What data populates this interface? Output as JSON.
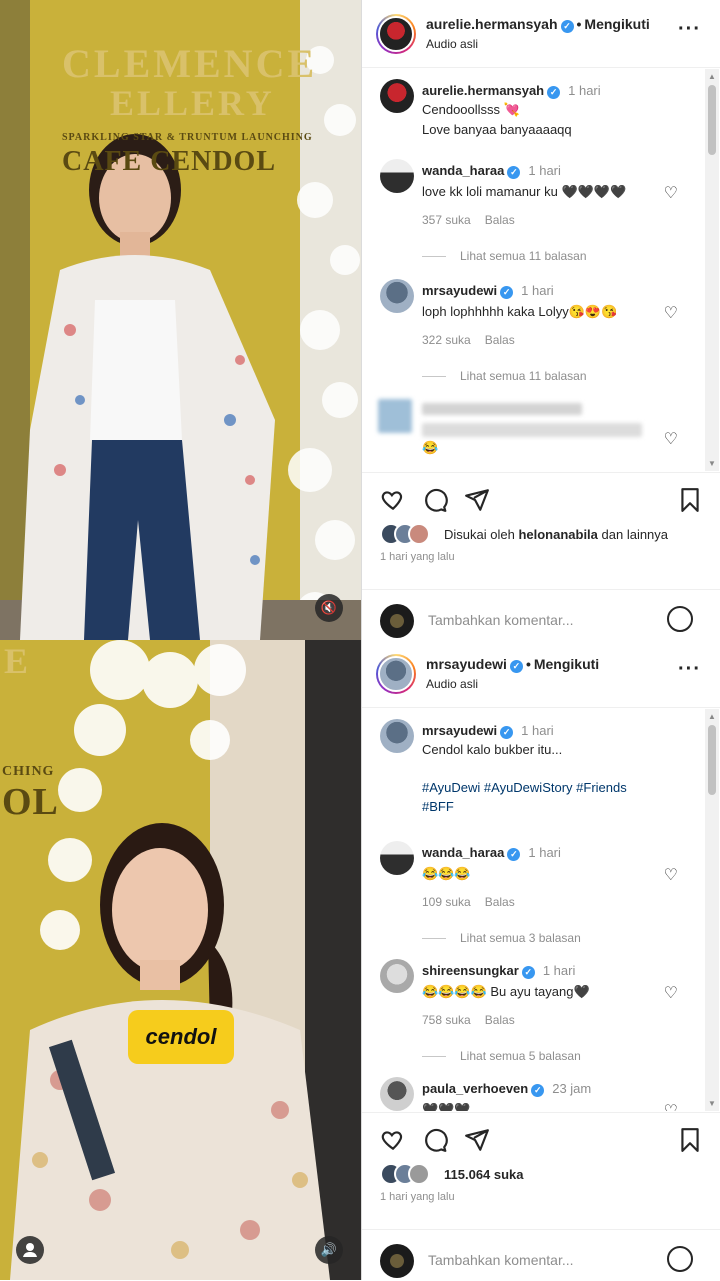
{
  "posts": [
    {
      "header": {
        "username": "aurelie.hermansyah",
        "follow": "Mengikuti",
        "audio": "Audio asli"
      },
      "caption": {
        "username": "aurelie.hermansyah",
        "time": "1 hari",
        "line1": "Cendooollsss 💘",
        "line2": "Love banyaa banyaaaaqq"
      },
      "comments": [
        {
          "username": "wanda_haraa",
          "time": "1 hari",
          "text": "love kk loli mamanur ku 🖤🖤🖤🖤",
          "likes": "357 suka",
          "reply": "Balas",
          "view_replies": "Lihat semua 11 balasan"
        },
        {
          "username": "mrsayudewi",
          "time": "1 hari",
          "text": "loph lophhhhh kaka Lolyy😘😍😘",
          "likes": "322 suka",
          "reply": "Balas",
          "view_replies": "Lihat semua 11 balasan"
        }
      ],
      "blurred_comment_emoji": "😂",
      "liked_by_prefix": "Disukai oleh ",
      "liked_by_user": "helonanabila",
      "liked_by_suffix": " dan lainnya",
      "posted_ago": "1 hari yang lalu",
      "add_comment_placeholder": "Tambahkan komentar...",
      "media_text": {
        "brand1": "CLEMENCE",
        "brand2": "ELLERY",
        "event": "SPARKLING STAR & TRUNTUM LAUNCHING",
        "event2": "CAFE CENDOL"
      }
    },
    {
      "header": {
        "username": "mrsayudewi",
        "follow": "Mengikuti",
        "audio": "Audio asli"
      },
      "caption": {
        "username": "mrsayudewi",
        "time": "1 hari",
        "line1": "Cendol kalo bukber itu...",
        "hashtags1": "#AyuDewi #AyuDewiStory #Friends",
        "hashtags2": "#BFF"
      },
      "comments": [
        {
          "username": "wanda_haraa",
          "time": "1 hari",
          "text": "😂😂😂",
          "likes": "109 suka",
          "reply": "Balas",
          "view_replies": "Lihat semua 3 balasan"
        },
        {
          "username": "shireensungkar",
          "time": "1 hari",
          "text": "😂😂😂😂 Bu ayu tayang🖤",
          "likes": "758 suka",
          "reply": "Balas",
          "view_replies": "Lihat semua 5 balasan"
        },
        {
          "username": "paula_verhoeven",
          "time": "23 jam",
          "text": "🖤🖤🖤"
        }
      ],
      "likes_count": "115.064 suka",
      "posted_ago": "1 hari yang lalu",
      "add_comment_placeholder": "Tambahkan komentar...",
      "media_text": {
        "brand_partial": "E",
        "event_partial": "CHING",
        "event2_partial": "OL",
        "sticker": "cendol"
      }
    }
  ],
  "colors": {
    "verified": "#3897f0",
    "link": "#00376b",
    "muted": "#8e8e8e",
    "wall": "#c9b13a"
  }
}
